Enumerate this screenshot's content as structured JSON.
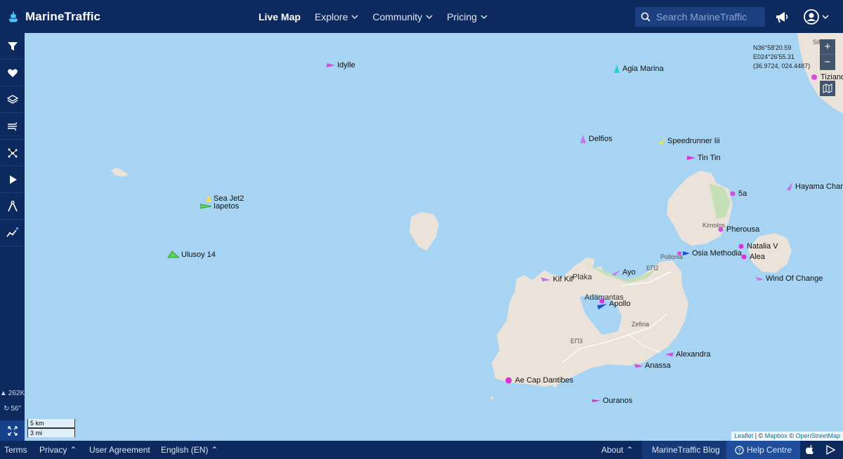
{
  "header": {
    "logo_text": "MarineTraffic",
    "nav": [
      {
        "label": "Live Map",
        "active": true,
        "dropdown": false
      },
      {
        "label": "Explore",
        "active": false,
        "dropdown": true
      },
      {
        "label": "Community",
        "active": false,
        "dropdown": true
      },
      {
        "label": "Pricing",
        "active": false,
        "dropdown": true
      }
    ],
    "search_placeholder": "Search MarineTraffic",
    "icons": [
      "megaphone-icon",
      "user-avatar-icon"
    ]
  },
  "sidebar": {
    "tools": [
      "filter-icon",
      "heart-icon",
      "layers-icon",
      "wind-icon",
      "density-icon",
      "play-icon",
      "measure-icon",
      "analytics-icon"
    ],
    "vessel_count": "262K",
    "refresh": "56\"",
    "bottom_icon": "fullscreen-icon"
  },
  "map": {
    "coordinates": {
      "lat": "N36°58'20.59",
      "lon": "E024°26'55.31",
      "decimal": "(36.9724, 024.4487)"
    },
    "zoom_in": "+",
    "zoom_out": "−",
    "scale_metric": "5 km",
    "scale_imperial": "3 mi",
    "attribution": {
      "leaflet": "Leaflet",
      "sep": " | © ",
      "mapbox": "Mapbox",
      "sep2": " © ",
      "osm": "OpenStreetMap"
    },
    "place_labels": [
      "Plaka",
      "Adamantas",
      "Zefiria",
      "Pollonia",
      "Kimolos",
      "ΕΠ2",
      "ΕΠ3",
      "Sifnos"
    ],
    "vessels": [
      {
        "name": "Idylle",
        "color": "#d24fe0"
      },
      {
        "name": "Agia Marina",
        "color": "#2ad4d4"
      },
      {
        "name": "Tiziano",
        "color": "#d24fe0"
      },
      {
        "name": "Delfios",
        "color": "#c774e8"
      },
      {
        "name": "Speedrunner Iii",
        "color": "#f5e04a"
      },
      {
        "name": "Tin Tin",
        "color": "#e02fd6"
      },
      {
        "name": "5a",
        "color": "#d24fe0"
      },
      {
        "name": "Hayama Chan",
        "color": "#c774e8"
      },
      {
        "name": "Sea Jet2",
        "color": "#f5e04a"
      },
      {
        "name": "Iapetos",
        "color": "#57d957"
      },
      {
        "name": "Pherousa",
        "color": "#d24fe0"
      },
      {
        "name": "Natalia V",
        "color": "#e02fd6"
      },
      {
        "name": "Osia Methodia",
        "color": "#1a4fd8"
      },
      {
        "name": "Alea",
        "color": "#e02fd6"
      },
      {
        "name": "Ulusoy 14",
        "color": "#57d957"
      },
      {
        "name": "Ayo",
        "color": "#c774e8"
      },
      {
        "name": "Kif Kif",
        "color": "#c774e8"
      },
      {
        "name": "Wind Of Change",
        "color": "#c774e8"
      },
      {
        "name": "Apollo",
        "color": "#1a4fd8"
      },
      {
        "name": "Alexandra",
        "color": "#d24fe0"
      },
      {
        "name": "Anassa",
        "color": "#d24fe0"
      },
      {
        "name": "Ae Cap Dantibes",
        "color": "#e02fd6"
      },
      {
        "name": "Ouranos",
        "color": "#e02fd6"
      }
    ]
  },
  "footer": {
    "terms": "Terms",
    "privacy": "Privacy",
    "user_agreement": "User Agreement",
    "language": "English (EN)",
    "about": "About",
    "blog": "MarineTraffic Blog",
    "help": "Help Centre"
  }
}
